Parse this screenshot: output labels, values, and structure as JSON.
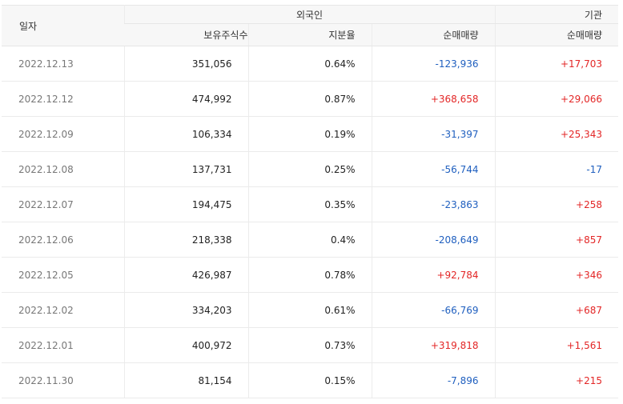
{
  "colors": {
    "positive": "#e32626",
    "negative": "#1f5fbf"
  },
  "header": {
    "date_label": "일자",
    "foreign_group": "외국인",
    "institution_group": "기관",
    "holdings_label": "보유주식수",
    "ratio_label": "지분율",
    "foreign_net_label": "순매매량",
    "institution_net_label": "순매매량"
  },
  "rows": [
    {
      "date": "2022.12.13",
      "holdings": "351,056",
      "ratio": "0.64%",
      "foreign_net": "-123,936",
      "institution_net": "+17,703"
    },
    {
      "date": "2022.12.12",
      "holdings": "474,992",
      "ratio": "0.87%",
      "foreign_net": "+368,658",
      "institution_net": "+29,066"
    },
    {
      "date": "2022.12.09",
      "holdings": "106,334",
      "ratio": "0.19%",
      "foreign_net": "-31,397",
      "institution_net": "+25,343"
    },
    {
      "date": "2022.12.08",
      "holdings": "137,731",
      "ratio": "0.25%",
      "foreign_net": "-56,744",
      "institution_net": "-17"
    },
    {
      "date": "2022.12.07",
      "holdings": "194,475",
      "ratio": "0.35%",
      "foreign_net": "-23,863",
      "institution_net": "+258"
    },
    {
      "date": "2022.12.06",
      "holdings": "218,338",
      "ratio": "0.4%",
      "foreign_net": "-208,649",
      "institution_net": "+857"
    },
    {
      "date": "2022.12.05",
      "holdings": "426,987",
      "ratio": "0.78%",
      "foreign_net": "+92,784",
      "institution_net": "+346"
    },
    {
      "date": "2022.12.02",
      "holdings": "334,203",
      "ratio": "0.61%",
      "foreign_net": "-66,769",
      "institution_net": "+687"
    },
    {
      "date": "2022.12.01",
      "holdings": "400,972",
      "ratio": "0.73%",
      "foreign_net": "+319,818",
      "institution_net": "+1,561"
    },
    {
      "date": "2022.11.30",
      "holdings": "81,154",
      "ratio": "0.15%",
      "foreign_net": "-7,896",
      "institution_net": "+215"
    }
  ]
}
